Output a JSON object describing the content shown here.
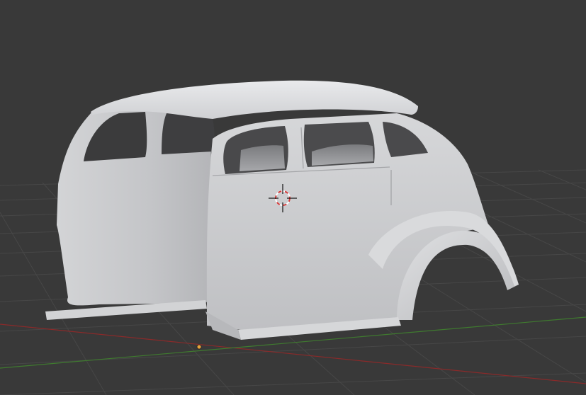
{
  "viewport": {
    "background_color": "#393939",
    "grid_color": "#474747",
    "x_axis_color": "#8a2a2a",
    "y_axis_color": "#3f7a2f",
    "origin_color": "#e6a43c",
    "cursor_ring_colors": [
      "#d43a3a",
      "#ffffff"
    ],
    "cursor_crosshair_color": "#111111",
    "model_color": "#c8c9cb"
  },
  "scene": {
    "object": "car-body-mesh",
    "object_type": "mesh",
    "shading": "solid"
  },
  "icons": {
    "cursor": "3d-cursor-icon",
    "origin": "origin-dot-icon"
  }
}
